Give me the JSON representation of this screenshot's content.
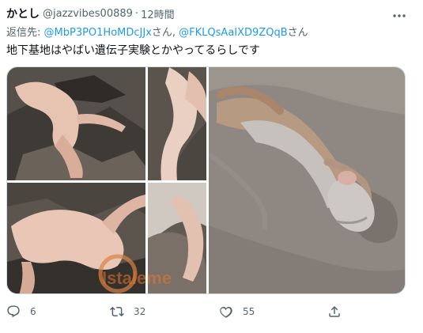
{
  "author": {
    "display_name": "かとし",
    "handle": "@jazzvibes00889",
    "separator": "·",
    "time": "12時間"
  },
  "more_icon": "more-horizontal-icon",
  "reply": {
    "prefix": "返信先: ",
    "mentions": [
      {
        "handle": "@MbP3PO1HoMDcJJx",
        "suffix": "さん, "
      },
      {
        "handle": "@FKLQsAaIXD9ZQqB",
        "suffix": "さん"
      }
    ]
  },
  "tweet_text": "地下基地はやばい遺伝子実験とかやってるらしです",
  "media": {
    "watermark": "Istaleme",
    "photos": [
      {
        "name": "photo-rocks-1",
        "subject": "pale-creature-on-rocks"
      },
      {
        "name": "photo-rocks-2",
        "subject": "pale-creature-on-rocks"
      },
      {
        "name": "photo-beach",
        "subject": "creature-carcass-on-sand"
      }
    ]
  },
  "actions": {
    "reply_count": "6",
    "retweet_count": "32",
    "like_count": "55"
  },
  "icons": [
    "reply-icon",
    "retweet-icon",
    "like-icon",
    "share-icon"
  ],
  "colors": {
    "text": "#0f1419",
    "secondary": "#536471",
    "link": "#1d9bf0",
    "border": "#cfd9de"
  }
}
